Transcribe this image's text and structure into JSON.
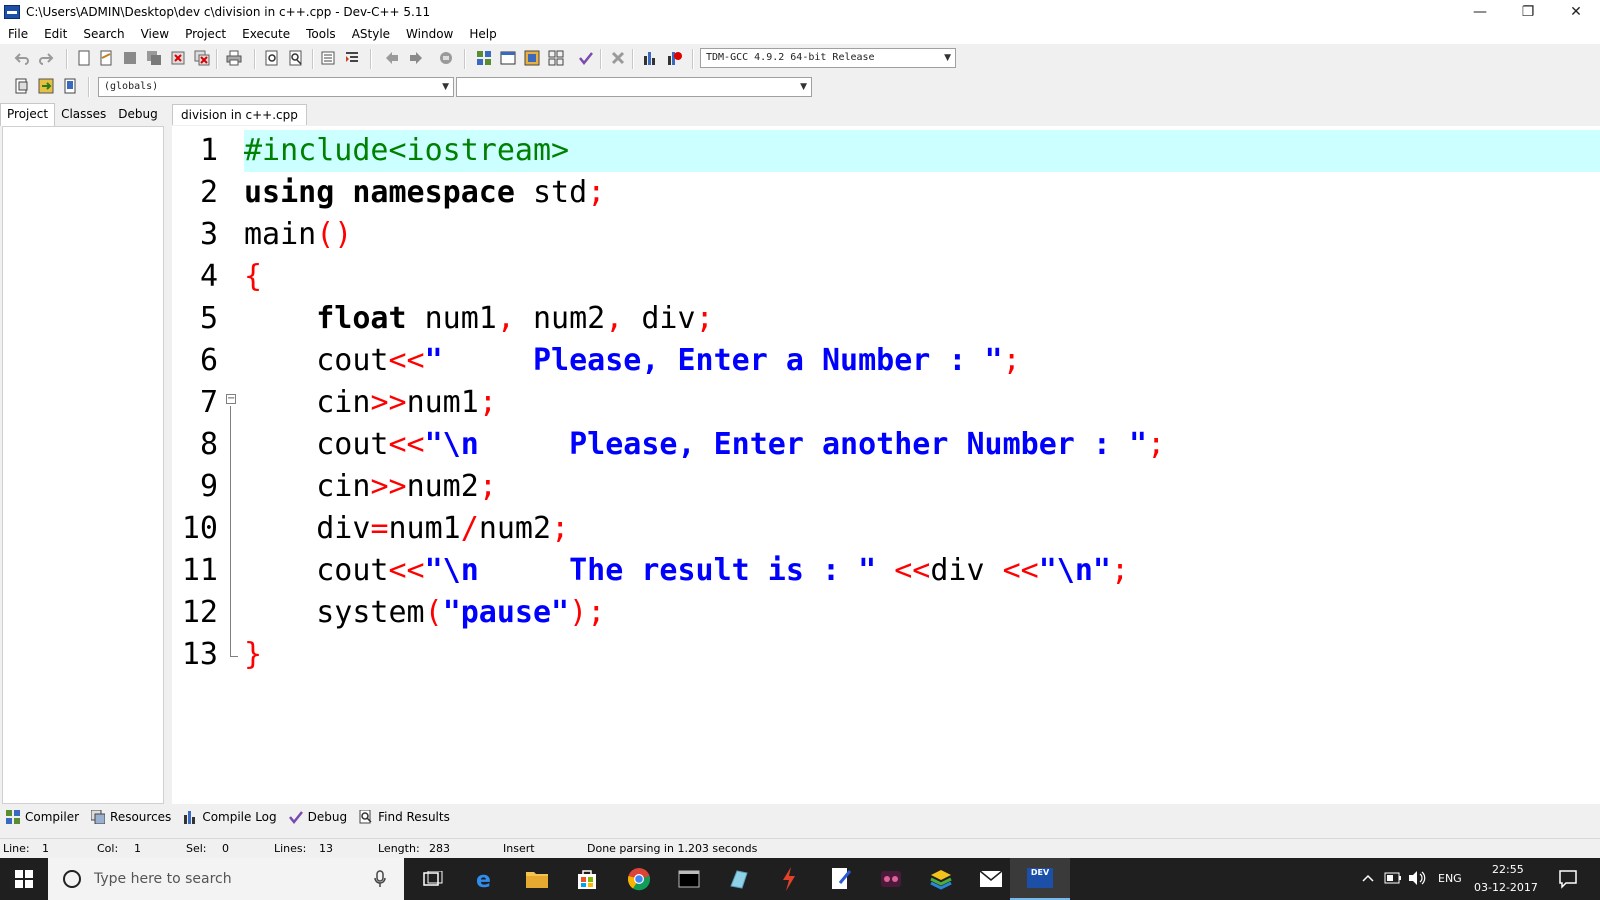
{
  "window": {
    "title": "C:\\Users\\ADMIN\\Desktop\\dev c\\division in c++.cpp - Dev-C++ 5.11",
    "minimize": "—",
    "restore": "❐",
    "close": "✕"
  },
  "menu": [
    "File",
    "Edit",
    "Search",
    "View",
    "Project",
    "Execute",
    "Tools",
    "AStyle",
    "Window",
    "Help"
  ],
  "toolbar": {
    "compiler_select": "TDM-GCC 4.9.2 64-bit Release",
    "scope_select": "(globals)",
    "function_select": ""
  },
  "left_tabs": [
    "Project",
    "Classes",
    "Debug"
  ],
  "editor": {
    "tab_label": "division in c++.cpp",
    "lines": [
      {
        "n": "1"
      },
      {
        "n": "2"
      },
      {
        "n": "3"
      },
      {
        "n": "4"
      },
      {
        "n": "5"
      },
      {
        "n": "6"
      },
      {
        "n": "7"
      },
      {
        "n": "8"
      },
      {
        "n": "9"
      },
      {
        "n": "10"
      },
      {
        "n": "11"
      },
      {
        "n": "12"
      },
      {
        "n": "13"
      }
    ],
    "code": {
      "l1": "#include<iostream>",
      "l2_kw": "using namespace",
      "l2_rest": " std",
      "l2_semi": ";",
      "l3_name": "main",
      "l3_paren": "()",
      "l4_brace": "{",
      "l5_kw": "float",
      "l5_a": " num1",
      "l5_c1": ",",
      "l5_b": " num2",
      "l5_c2": ",",
      "l5_c": " div",
      "l5_semi": ";",
      "l6_id": "cout",
      "l6_op": "<<",
      "l6_str": "\"     Please, Enter a Number : \"",
      "l6_semi": ";",
      "l7_id": "cin",
      "l7_op": ">>",
      "l7_v": "num1",
      "l7_semi": ";",
      "l8_id": "cout",
      "l8_op": "<<",
      "l8_str": "\"\\n     Please, Enter another Number : \"",
      "l8_semi": ";",
      "l9_id": "cin",
      "l9_op": ">>",
      "l9_v": "num2",
      "l9_semi": ";",
      "l10_a": "div",
      "l10_eq": "=",
      "l10_b": "num1",
      "l10_sl": "/",
      "l10_c": "num2",
      "l10_semi": ";",
      "l11_id": "cout",
      "l11_op1": "<<",
      "l11_str1": "\"\\n     The result is : \"",
      "l11_op2": " <<",
      "l11_v": "div ",
      "l11_op3": "<<",
      "l11_str2": "\"\\n\"",
      "l11_semi": ";",
      "l12_id": "system",
      "l12_p1": "(",
      "l12_str": "\"pause\"",
      "l12_p2": ")",
      "l12_semi": ";",
      "l13_brace": "}"
    }
  },
  "bottom_tabs": [
    "Compiler",
    "Resources",
    "Compile Log",
    "Debug",
    "Find Results"
  ],
  "status": {
    "line_label": "Line:",
    "line_val": "1",
    "col_label": "Col:",
    "col_val": "1",
    "sel_label": "Sel:",
    "sel_val": "0",
    "lines_label": "Lines:",
    "lines_val": "13",
    "length_label": "Length:",
    "length_val": "283",
    "mode": "Insert",
    "message": "Done parsing in 1.203 seconds"
  },
  "taskbar": {
    "search_placeholder": "Type here to search",
    "lang": "ENG",
    "time": "22:55",
    "date": "03-12-2017",
    "dev_badge": "DEV"
  }
}
